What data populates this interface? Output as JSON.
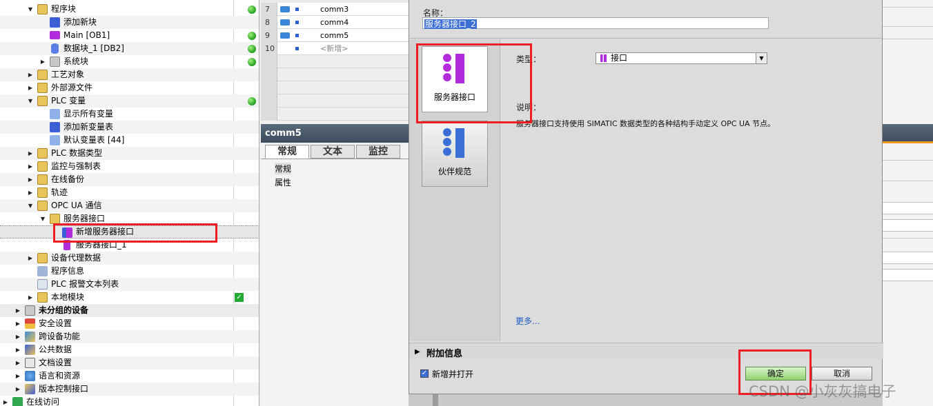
{
  "tree": {
    "items": [
      {
        "label": "程序块",
        "status": "green",
        "bold": false
      },
      {
        "label": "添加新块"
      },
      {
        "label": "Main [OB1]",
        "status": "green"
      },
      {
        "label": "数据块_1 [DB2]",
        "status": "green"
      },
      {
        "label": "系统块",
        "status": "green"
      },
      {
        "label": "工艺对象"
      },
      {
        "label": "外部源文件"
      },
      {
        "label": "PLC 变量",
        "status": "green"
      },
      {
        "label": "显示所有变量"
      },
      {
        "label": "添加新变量表"
      },
      {
        "label": "默认变量表 [44]"
      },
      {
        "label": "PLC 数据类型"
      },
      {
        "label": "监控与强制表"
      },
      {
        "label": "在线备份"
      },
      {
        "label": "轨迹"
      },
      {
        "label": "OPC UA 通信"
      },
      {
        "label": "服务器接口"
      },
      {
        "label": "新增服务器接口"
      },
      {
        "label": "服务器接口_1"
      },
      {
        "label": "设备代理数据"
      },
      {
        "label": "程序信息"
      },
      {
        "label": "PLC 报警文本列表"
      },
      {
        "label": "本地模块",
        "status": "check"
      },
      {
        "label": "未分组的设备"
      },
      {
        "label": "安全设置"
      },
      {
        "label": "跨设备功能"
      },
      {
        "label": "公共数据"
      },
      {
        "label": "文档设置"
      },
      {
        "label": "语言和资源"
      },
      {
        "label": "版本控制接口"
      },
      {
        "label": "在线访问"
      }
    ]
  },
  "table": {
    "rows": [
      {
        "num": "7",
        "name": "comm3"
      },
      {
        "num": "8",
        "name": "comm4"
      },
      {
        "num": "9",
        "name": "comm5"
      },
      {
        "num": "10",
        "name": "<新增>"
      }
    ]
  },
  "props": {
    "title": "comm5",
    "tabs": [
      "常规",
      "文本",
      "监控"
    ],
    "items": [
      "常规",
      "属性"
    ]
  },
  "dialog": {
    "name_label": "名称：",
    "name_value": "服务器接口_2",
    "cards": [
      "服务器接口",
      "伙伴规范"
    ],
    "type_label": "类型：",
    "type_value": "接口",
    "desc_label": "说明：",
    "desc_text": "服务器接口支持使用 SIMATIC 数据类型的各种结构手动定义 OPC UA 节点。",
    "more": "更多...",
    "extra_info": "附加信息",
    "add_open": "新增并打开",
    "ok": "确定",
    "cancel": "取消"
  },
  "watermark": "CSDN @小灰灰搞电子",
  "colors": {
    "accent_red": "#ee1c25",
    "interface_purple": "#b22cdb",
    "partner_blue": "#3a6fd6",
    "status_green": "#1f9d1f",
    "ok_green": "#8fd16f"
  }
}
